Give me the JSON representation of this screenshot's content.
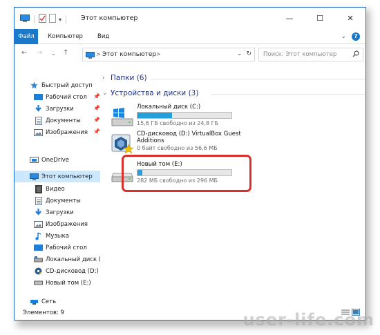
{
  "window": {
    "title": "Этот компьютер",
    "controls": {
      "minimize": "—",
      "maximize": "☐",
      "close": "✕"
    }
  },
  "ribbon": {
    "tabs": [
      "Файл",
      "Компьютер",
      "Вид"
    ],
    "expand_icon": "chevron-down-icon",
    "help_label": "?"
  },
  "address": {
    "path": [
      "Этот компьютер"
    ],
    "separator": ">",
    "refresh_icon": "refresh-icon"
  },
  "search": {
    "placeholder": "Поиск: Этот компьютер"
  },
  "nav": {
    "quick_access": "Быстрый доступ",
    "quick_items": [
      {
        "label": "Рабочий стол",
        "icon": "desktop-icon"
      },
      {
        "label": "Загрузки",
        "icon": "download-icon"
      },
      {
        "label": "Документы",
        "icon": "documents-icon"
      },
      {
        "label": "Изображения",
        "icon": "pictures-icon"
      }
    ],
    "onedrive": "OneDrive",
    "this_pc": "Этот компьютер",
    "pc_items": [
      {
        "label": "Видео",
        "icon": "video-icon"
      },
      {
        "label": "Документы",
        "icon": "documents-icon"
      },
      {
        "label": "Загрузки",
        "icon": "download-icon"
      },
      {
        "label": "Изображения",
        "icon": "pictures-icon"
      },
      {
        "label": "Музыка",
        "icon": "music-icon"
      },
      {
        "label": "Рабочий стол",
        "icon": "desktop-icon"
      },
      {
        "label": "Локальный диск (C:",
        "icon": "drive-icon"
      },
      {
        "label": "CD-дисковод (D:) Vi",
        "icon": "cd-icon"
      },
      {
        "label": "Новый том (E:)",
        "icon": "drive-icon"
      }
    ],
    "network": "Сеть"
  },
  "content": {
    "folders_header": "Папки (6)",
    "drives_header": "Устройства и диски (3)",
    "drives": [
      {
        "name": "Локальный диск (C:)",
        "free": "15,6 ГБ свободно из 24,8 ГБ",
        "used_fraction": 0.37,
        "icon": "windows-drive-icon"
      },
      {
        "name": "CD-дисковод (D:) VirtualBox Guest",
        "name2": "Additions",
        "free": "0 байт свободно из 56,6 МБ",
        "icon": "virtualbox-cd-icon"
      },
      {
        "name": "Новый том (E:)",
        "free": "282 МБ свободно из 296 МБ",
        "used_fraction": 0.05,
        "icon": "drive-icon"
      }
    ]
  },
  "status": {
    "items": "Элементов: 9"
  },
  "watermark": "user-life.com",
  "colors": {
    "accent": "#1979ca",
    "selected": "#cce8ff",
    "bar": "#26a0da",
    "highlight": "#d6312b"
  }
}
